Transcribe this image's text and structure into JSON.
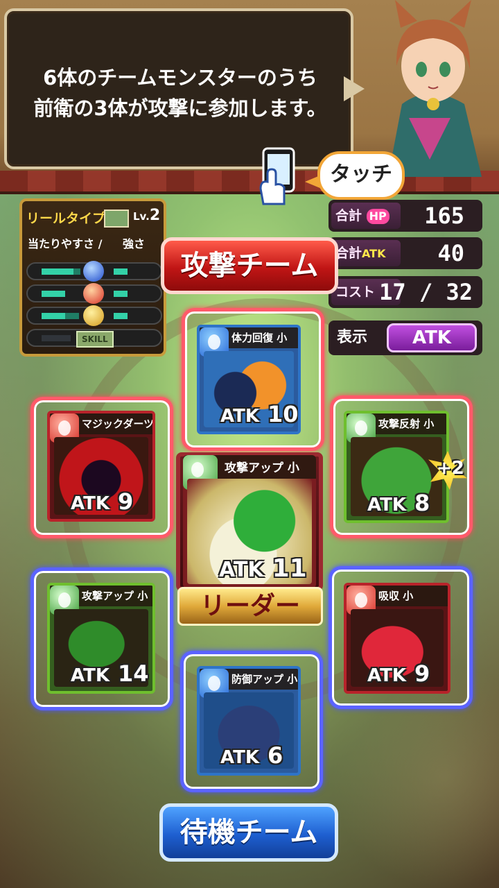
{
  "dialog": {
    "line1": "6体のチームモンスターのうち",
    "line2": "前衛の3体が攻撃に参加します。"
  },
  "touch_prompt": "タッチ",
  "reel_panel": {
    "title": "リールタイプ:",
    "level_prefix": "Lv.",
    "level": "2",
    "label_hit": "当たりやすさ /",
    "label_strength": "強さ",
    "skill_tag": "SKILL"
  },
  "stats": {
    "total_hp_label": "合計",
    "hp_badge": "HP",
    "total_hp": "165",
    "total_atk_label": "合計",
    "atk_badge": "ATK",
    "total_atk": "40",
    "cost_label": "コスト",
    "cost": "17 / 32",
    "display_label": "表示",
    "display_value": "ATK"
  },
  "teams": {
    "attack_label": "攻撃チーム",
    "wait_label": "待機チーム",
    "leader_label": "リーダー"
  },
  "monsters": [
    {
      "slot": "attack-top",
      "skill": "体力回復 小",
      "element": "water",
      "atk_label": "ATK",
      "atk": "10"
    },
    {
      "slot": "attack-left",
      "skill": "マジックダーツ",
      "element": "fire",
      "atk_label": "ATK",
      "atk": "9"
    },
    {
      "slot": "attack-right",
      "skill": "攻撃反射 小",
      "element": "leaf",
      "atk_label": "ATK",
      "atk": "8",
      "bonus": "+2"
    },
    {
      "slot": "leader",
      "skill": "攻撃アップ 小",
      "element": "leaf",
      "atk_label": "ATK",
      "atk": "11"
    },
    {
      "slot": "wait-left",
      "skill": "攻撃アップ 小",
      "element": "leaf",
      "atk_label": "ATK",
      "atk": "14"
    },
    {
      "slot": "wait-right",
      "skill": "吸収 小",
      "element": "fire",
      "atk_label": "ATK",
      "atk": "9"
    },
    {
      "slot": "wait-bottom",
      "skill": "防御アップ 小",
      "element": "water",
      "atk_label": "ATK",
      "atk": "6"
    }
  ],
  "colors": {
    "attack_team": "#c01515",
    "wait_team": "#1e5fd0",
    "display_button": "#7a1d9b"
  }
}
